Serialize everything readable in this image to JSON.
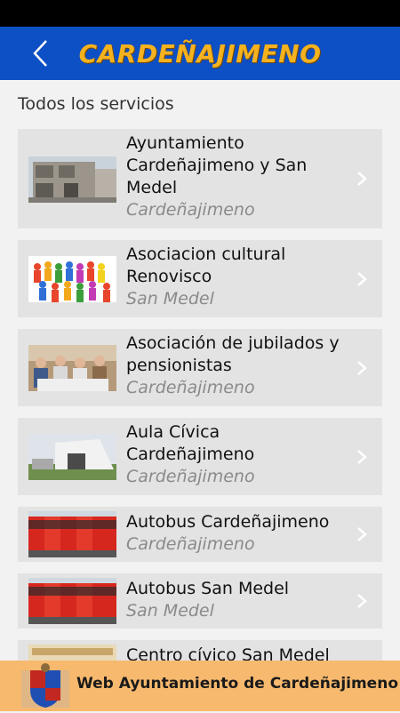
{
  "header": {
    "logo_text": "CARDEÑAJIMENO"
  },
  "section_title": "Todos los servicios",
  "items": [
    {
      "title": "Ayuntamiento Cardeñajimeno y San Medel",
      "location": "Cardeñajimeno",
      "icon": "town-hall-photo"
    },
    {
      "title": "Asociacion cultural Renovisco",
      "location": "San Medel",
      "icon": "people-group-photo"
    },
    {
      "title": "Asociación de jubilados y pensionistas",
      "location": "Cardeñajimeno",
      "icon": "seniors-photo"
    },
    {
      "title": "Aula Cívica Cardeñajimeno",
      "location": "Cardeñajimeno",
      "icon": "building-photo"
    },
    {
      "title": "Autobus Cardeñajimeno",
      "location": "Cardeñajimeno",
      "icon": "buses-photo"
    },
    {
      "title": "Autobus San Medel",
      "location": "San Medel",
      "icon": "buses-photo"
    },
    {
      "title": "Centro cívico San Medel",
      "location": "",
      "icon": "poster-photo"
    }
  ],
  "footer": {
    "text": "Web Ayuntamiento de Cardeñajimeno"
  },
  "colors": {
    "appbar": "#0d4fc4",
    "logo": "#f5b21f",
    "footer": "#f7b96e"
  }
}
